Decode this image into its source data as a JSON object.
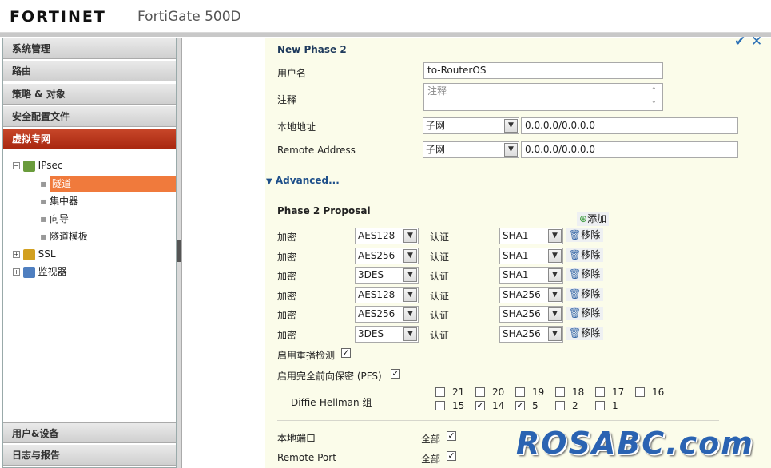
{
  "header": {
    "brand": "FORTINET",
    "model": "FortiGate 500D"
  },
  "sidebar": {
    "categories": [
      "系统管理",
      "路由",
      "策略 & 对象",
      "安全配置文件",
      "虚拟专网"
    ],
    "tree": [
      {
        "label": "IPsec"
      },
      {
        "label": "隧道"
      },
      {
        "label": "集中器"
      },
      {
        "label": "向导"
      },
      {
        "label": "隧道模板"
      },
      {
        "label": "SSL"
      },
      {
        "label": "监视器"
      }
    ],
    "bottom": [
      "用户&设备",
      "日志与报告"
    ]
  },
  "form": {
    "title": "New Phase 2",
    "toolbar": {
      "ok_icon": "✔",
      "close_icon": "✕"
    },
    "name": {
      "label": "用户名",
      "value": "to-RouterOS"
    },
    "comment": {
      "label": "注释",
      "placeholder": "注释"
    },
    "local": {
      "label": "本地地址",
      "type": "子网",
      "value": "0.0.0.0/0.0.0.0"
    },
    "remote": {
      "label": "Remote Address",
      "type": "子网",
      "value": "0.0.0.0/0.0.0.0"
    },
    "advanced": "Advanced...",
    "proposal": {
      "title": "Phase 2 Proposal",
      "add": "添加",
      "enc_label": "加密",
      "auth_label": "认证",
      "remove": "移除",
      "rows": [
        {
          "enc": "AES128",
          "auth": "SHA1"
        },
        {
          "enc": "AES256",
          "auth": "SHA1"
        },
        {
          "enc": "3DES",
          "auth": "SHA1"
        },
        {
          "enc": "AES128",
          "auth": "SHA256"
        },
        {
          "enc": "AES256",
          "auth": "SHA256"
        },
        {
          "enc": "3DES",
          "auth": "SHA256"
        }
      ]
    },
    "replay": {
      "label": "启用重播检测",
      "checked": true
    },
    "pfs": {
      "label": "启用完全前向保密 (PFS)",
      "checked": true
    },
    "dh": {
      "label": "Diffie-Hellman 组",
      "groups": [
        {
          "n": "21",
          "c": false
        },
        {
          "n": "20",
          "c": false
        },
        {
          "n": "19",
          "c": false
        },
        {
          "n": "18",
          "c": false
        },
        {
          "n": "17",
          "c": false
        },
        {
          "n": "16",
          "c": false
        },
        {
          "n": "15",
          "c": false
        },
        {
          "n": "14",
          "c": true
        },
        {
          "n": "5",
          "c": true
        },
        {
          "n": "2",
          "c": false
        },
        {
          "n": "1",
          "c": false
        }
      ]
    },
    "local_port": {
      "label": "本地端口",
      "all": "全部",
      "checked": true
    },
    "remote_port": {
      "label": "Remote Port",
      "all": "全部",
      "checked": true
    }
  },
  "watermark": "ROSABC.com"
}
